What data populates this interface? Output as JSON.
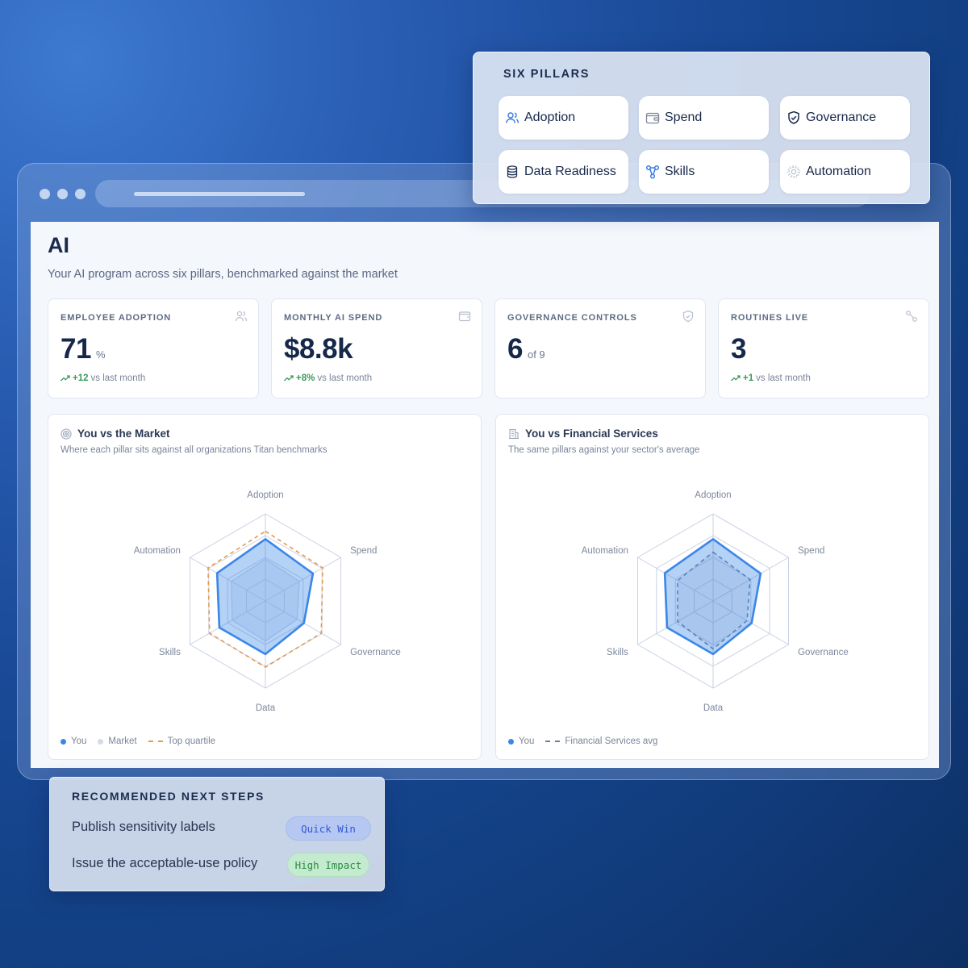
{
  "page": {
    "title": "AI",
    "subtitle": "Your AI program across six pillars, benchmarked against the market"
  },
  "kpis": [
    {
      "label": "EMPLOYEE ADOPTION",
      "icon": "users-icon",
      "value": "71",
      "suffix": "%",
      "delta": "+12",
      "trend_text": "vs last month"
    },
    {
      "label": "MONTHLY AI SPEND",
      "icon": "wallet-icon",
      "value": "$8.8k",
      "suffix": "",
      "delta": "+8%",
      "trend_text": "vs last month"
    },
    {
      "label": "GOVERNANCE CONTROLS",
      "icon": "shield-icon",
      "value": "6",
      "suffix": "of 9",
      "delta": "",
      "trend_text": ""
    },
    {
      "label": "ROUTINES LIVE",
      "icon": "workflow-icon",
      "value": "3",
      "suffix": "",
      "delta": "+1",
      "trend_text": "vs last month"
    }
  ],
  "market_card": {
    "title": "You vs the Market",
    "subtitle": "Where each pillar sits against all organizations Titan benchmarks",
    "legend": {
      "you": "You",
      "market": "Market",
      "top": "Top quartile"
    }
  },
  "sector_card": {
    "title": "You vs Financial Services",
    "subtitle": "The same pillars against your sector's average",
    "legend": {
      "you": "You",
      "sector": "Financial Services avg"
    }
  },
  "chart_data": [
    {
      "type": "radar",
      "title": "You vs the Market",
      "axes": [
        "Adoption",
        "Spend",
        "Governance",
        "Data",
        "Skills",
        "Automation"
      ],
      "rings": 4,
      "max": 100,
      "series": [
        {
          "name": "You",
          "values": [
            71,
            63,
            51,
            61,
            61,
            64
          ],
          "color": "#3b86e8"
        },
        {
          "name": "Market",
          "values": [
            48,
            45,
            42,
            46,
            44,
            45
          ],
          "color": "#c9d6ea"
        },
        {
          "name": "Top quartile",
          "values": [
            80,
            76,
            74,
            76,
            74,
            76
          ],
          "color": "#e49a52",
          "dashed": true
        }
      ]
    },
    {
      "type": "radar",
      "title": "You vs Financial Services",
      "axes": [
        "Adoption",
        "Spend",
        "Governance",
        "Data",
        "Skills",
        "Automation"
      ],
      "rings": 4,
      "max": 100,
      "series": [
        {
          "name": "You",
          "values": [
            71,
            63,
            51,
            61,
            61,
            64
          ],
          "color": "#3b86e8"
        },
        {
          "name": "Financial Services avg",
          "values": [
            56,
            49,
            45,
            55,
            47,
            47
          ],
          "color": "#6f7e98",
          "dashed": true
        }
      ]
    }
  ],
  "pillars": {
    "title": "SIX PILLARS",
    "items": [
      {
        "label": "Adoption",
        "icon": "users-icon"
      },
      {
        "label": "Spend",
        "icon": "wallet-icon"
      },
      {
        "label": "Governance",
        "icon": "shield-icon"
      },
      {
        "label": "Data Readiness",
        "icon": "database-icon"
      },
      {
        "label": "Skills",
        "icon": "network-icon"
      },
      {
        "label": "Automation",
        "icon": "gear-icon"
      }
    ]
  },
  "recommendations": {
    "title": "RECOMMENDED NEXT STEPS",
    "items": [
      {
        "text": "Publish sensitivity labels",
        "badge": "Quick Win"
      },
      {
        "text": "Issue the acceptable-use policy",
        "badge": "High Impact"
      }
    ]
  }
}
